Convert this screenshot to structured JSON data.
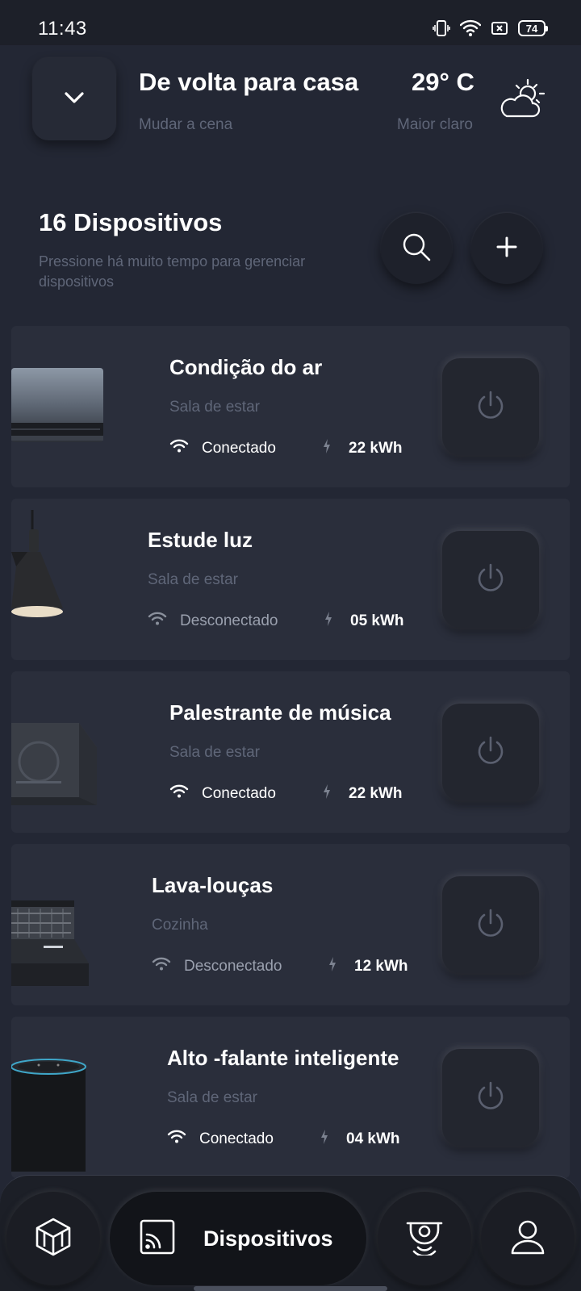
{
  "status_bar": {
    "time": "11:43",
    "battery": "74"
  },
  "scene": {
    "title": "De volta para casa",
    "subtitle": "Mudar a cena",
    "temperature": "29° C",
    "weather": "Maior claro"
  },
  "devices": {
    "title": "16 Dispositivos",
    "hint": "Pressione há muito tempo para gerenciar dispositivos",
    "items": [
      {
        "name": "Condição do ar",
        "room": "Sala de estar",
        "status": "Conectado",
        "energy": "22 kWh",
        "connected": true
      },
      {
        "name": "Estude luz",
        "room": "Sala de estar",
        "status": "Desconectado",
        "energy": "05 kWh",
        "connected": false
      },
      {
        "name": "Palestrante de música",
        "room": "Sala de estar",
        "status": "Conectado",
        "energy": "22 kWh",
        "connected": true
      },
      {
        "name": "Lava-louças",
        "room": "Cozinha",
        "status": "Desconectado",
        "energy": "12 kWh",
        "connected": false
      },
      {
        "name": "Alto -falante inteligente",
        "room": "Sala de estar",
        "status": "Conectado",
        "energy": "04 kWh",
        "connected": true
      }
    ]
  },
  "nav": {
    "active_label": "Dispositivos"
  }
}
